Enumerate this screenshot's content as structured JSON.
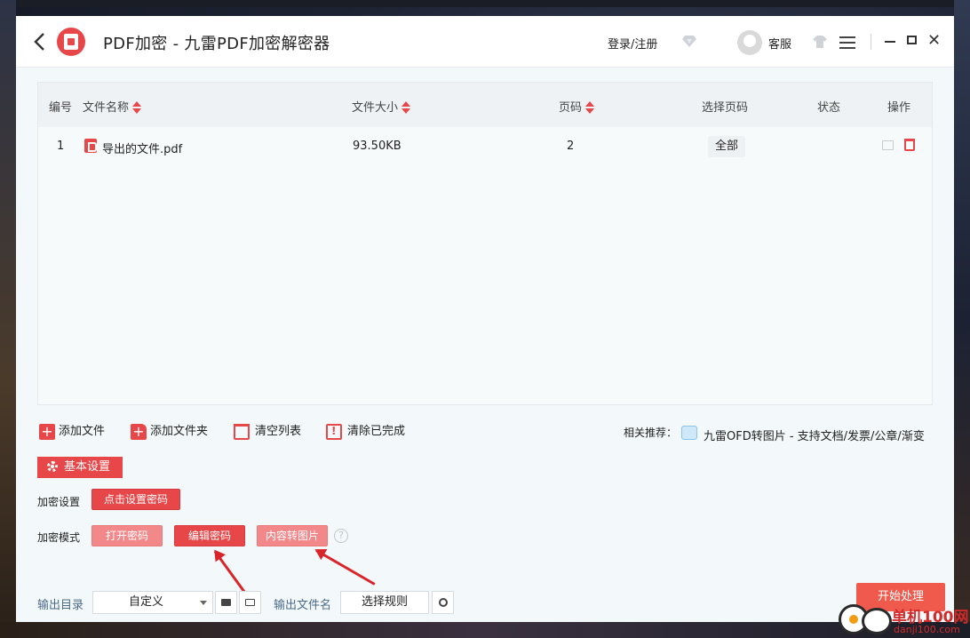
{
  "app": {
    "title": "PDF加密 - 九雷PDF加密解密器",
    "login": "登录/注册",
    "support": "客服",
    "vip_icon": "diamond-icon",
    "skin_icon": "tshirt-icon"
  },
  "table": {
    "headers": {
      "index": "编号",
      "name": "文件名称",
      "size": "文件大小",
      "pages": "页码",
      "range": "选择页码",
      "status": "状态",
      "ops": "操作"
    },
    "rows": [
      {
        "index": "1",
        "name": "导出的文件.pdf",
        "size": "93.50KB",
        "pages": "2",
        "range": "全部",
        "status": ""
      }
    ]
  },
  "actions": {
    "add_file": "添加文件",
    "add_folder": "添加文件夹",
    "clear_list": "清空列表",
    "clear_done": "清除已完成",
    "recommend_label": "相关推荐：",
    "recommend_link": "九雷OFD转图片 - 支持文档/发票/公章/渐变"
  },
  "settings": {
    "basic": "基本设置",
    "encrypt_setting_label": "加密设置",
    "set_password": "点击设置密码",
    "encrypt_mode_label": "加密模式",
    "mode_open": "打开密码",
    "mode_edit": "编辑密码",
    "mode_image": "内容转图片",
    "help": "?"
  },
  "output": {
    "dir_label": "输出目录",
    "dir_value": "自定义",
    "name_label": "输出文件名",
    "rule_button": "选择规则",
    "start": "开始处理"
  },
  "watermark": {
    "text": "单机100网",
    "url": "danji100.com"
  },
  "colors": {
    "accent": "#e8474a",
    "accent_light": "#f2888a",
    "start": "#f05a4c",
    "arrow": "#d9252a"
  }
}
